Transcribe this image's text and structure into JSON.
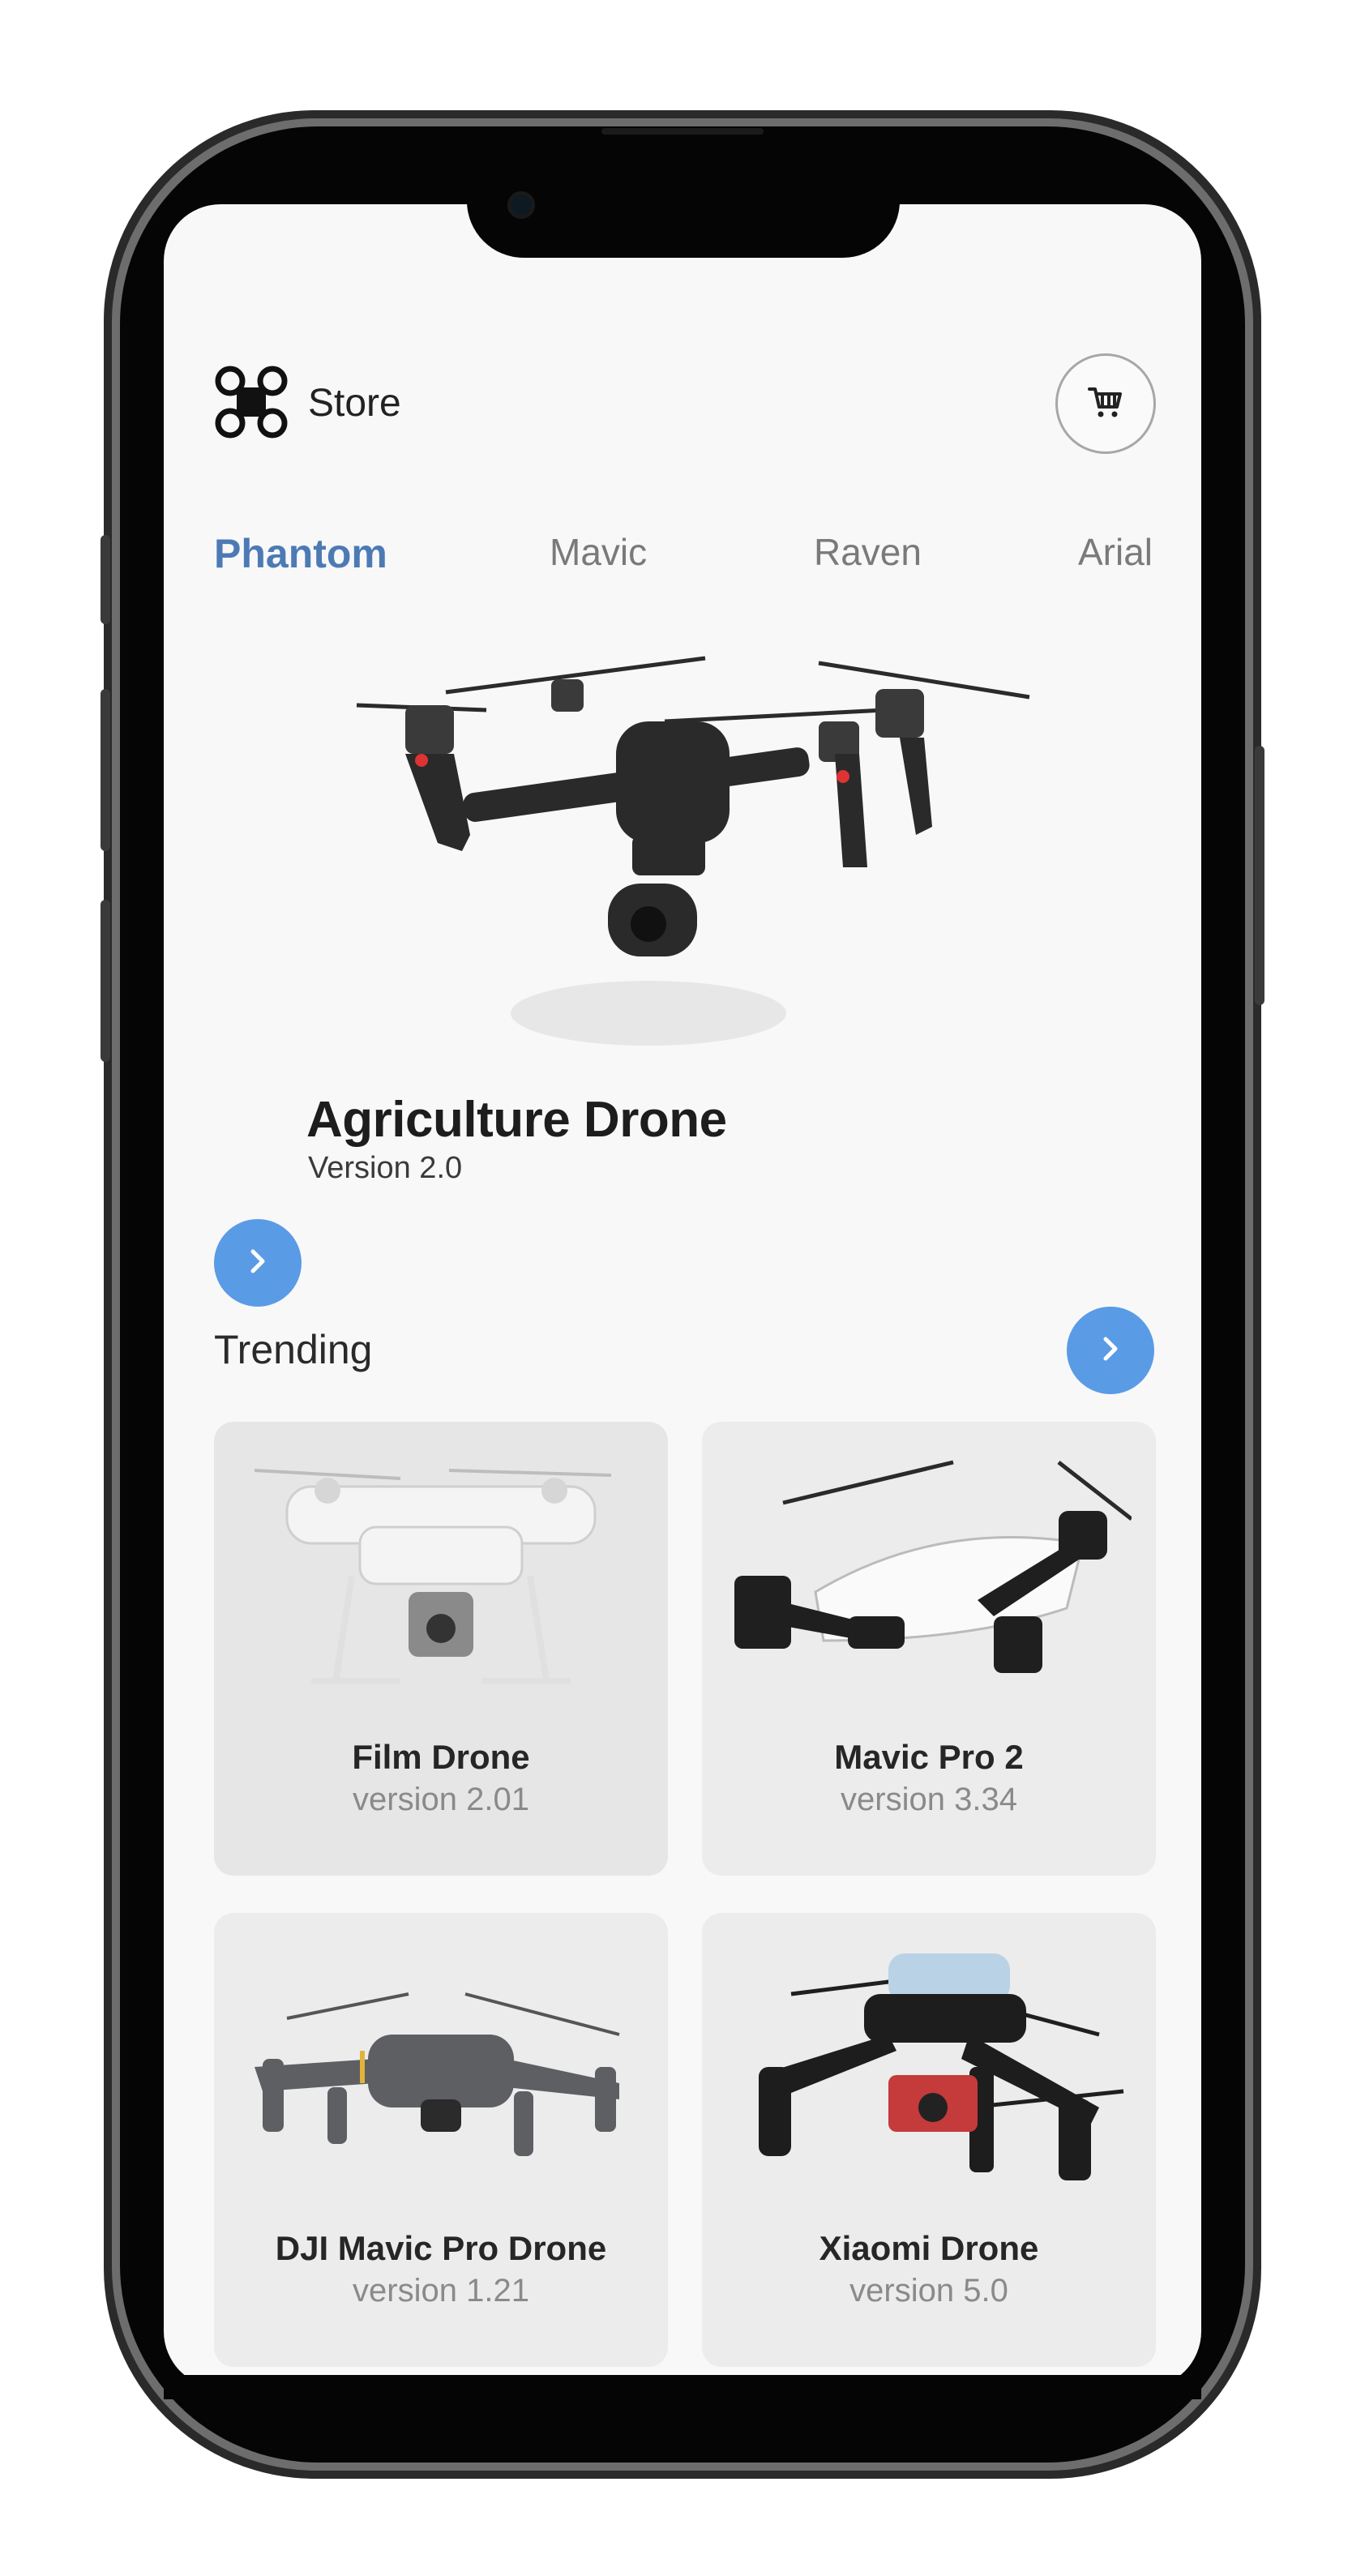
{
  "header": {
    "store_label": "Store",
    "logo_icon": "drone-logo-icon",
    "cart_icon": "shopping-cart-icon"
  },
  "tabs": [
    {
      "label": "Phantom",
      "active": true
    },
    {
      "label": "Mavic",
      "active": false
    },
    {
      "label": "Raven",
      "active": false
    },
    {
      "label": "Arial",
      "active": false
    }
  ],
  "hero": {
    "title": "Agriculture Drone",
    "subtitle": "Version 2.0",
    "next_icon": "chevron-right-icon"
  },
  "trending": {
    "title": "Trending",
    "next_icon": "chevron-right-icon",
    "items": [
      {
        "name": "Film Drone",
        "version": "version 2.01"
      },
      {
        "name": "Mavic Pro 2",
        "version": "version 3.34"
      },
      {
        "name": "DJI Mavic Pro Drone",
        "version": "version 1.21"
      },
      {
        "name": "Xiaomi Drone",
        "version": "version 5.0"
      }
    ]
  },
  "colors": {
    "accent": "#4c7ab5",
    "button": "#5a9be6",
    "background": "#f8f8f8",
    "card": "#ececec"
  }
}
